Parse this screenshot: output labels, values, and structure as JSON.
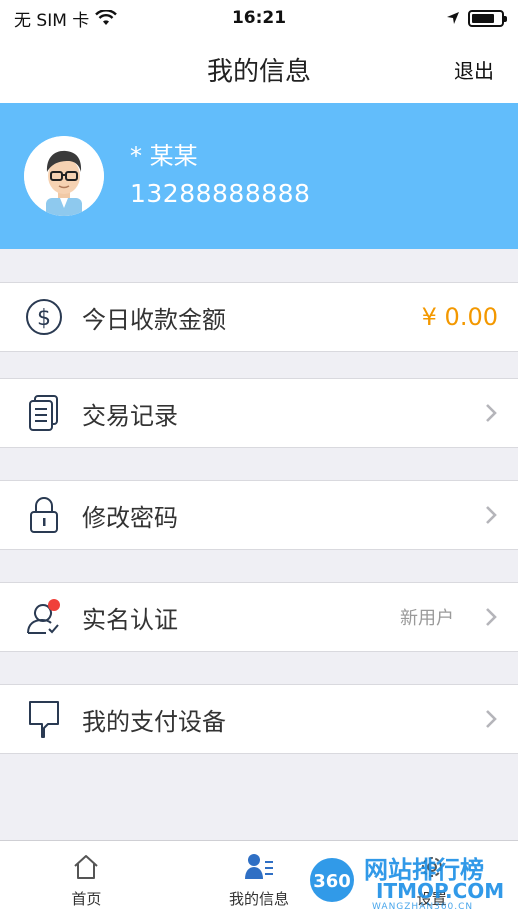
{
  "status_bar": {
    "carrier": "无 SIM 卡",
    "time": "16:21"
  },
  "nav": {
    "title": "我的信息",
    "logout_label": "退出"
  },
  "profile": {
    "name": "* 某某",
    "phone": "13288888888"
  },
  "menu": {
    "today_income": {
      "label": "今日收款金额",
      "amount": "¥ 0.00"
    },
    "transactions": {
      "label": "交易记录"
    },
    "change_password": {
      "label": "修改密码"
    },
    "verification": {
      "label": "实名认证",
      "status": "新用户"
    },
    "devices": {
      "label": "我的支付设备"
    }
  },
  "tabs": [
    {
      "label": "首页",
      "icon": "home-icon"
    },
    {
      "label": "我的信息",
      "icon": "profile-icon"
    },
    {
      "label": "设置",
      "icon": "gear-icon"
    }
  ],
  "watermark": {
    "badge": "360",
    "brand": "网站排行榜",
    "site": "ITMOP.COM",
    "sub": "WANGZHAN360.CN"
  },
  "colors": {
    "header_blue": "#62bdfb",
    "amount_orange": "#f39800",
    "icon_navy": "#2a3a52",
    "notify_red": "#f0403a"
  }
}
